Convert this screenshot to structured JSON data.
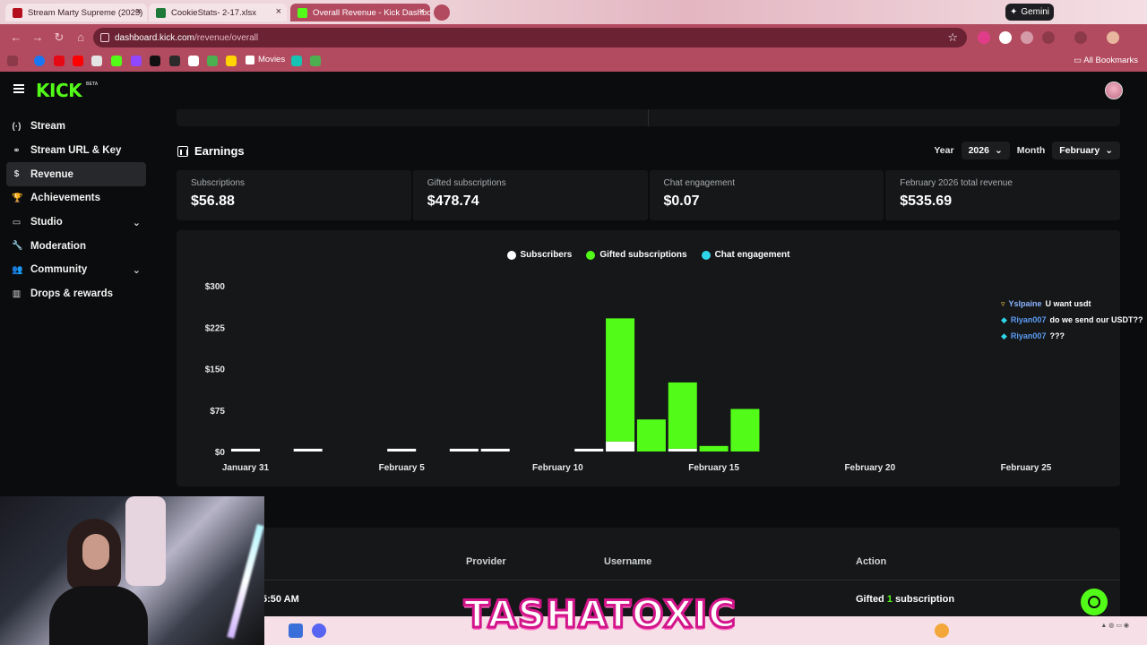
{
  "browser": {
    "tabs": [
      {
        "title": "Stream Marty Supreme (2025)",
        "fav": "#b30f1c"
      },
      {
        "title": "CookieStats- 2-17.xlsx",
        "fav": "#1f7a3a"
      },
      {
        "title": "Overall Revenue - Kick Dashbo",
        "fav": "#53fc18"
      }
    ],
    "gemini_label": "Gemini",
    "url_domain": "dashboard.kick.com",
    "url_path": "/revenue/overall",
    "bookmark_movies": "Movies",
    "all_bookmarks": "All Bookmarks"
  },
  "app": {
    "logo": "KICK",
    "beta": "BETA",
    "sidebar": [
      {
        "label": "Stream",
        "icon": "(·)"
      },
      {
        "label": "Stream URL & Key",
        "icon": "⚭"
      },
      {
        "label": "Revenue",
        "icon": "$",
        "active": true
      },
      {
        "label": "Achievements",
        "icon": "🏆"
      },
      {
        "label": "Studio",
        "icon": "▭",
        "expand": true
      },
      {
        "label": "Moderation",
        "icon": "🔧"
      },
      {
        "label": "Community",
        "icon": "👥",
        "expand": true
      },
      {
        "label": "Drops & rewards",
        "icon": "▥"
      }
    ],
    "earnings": {
      "title": "Earnings",
      "year_label": "Year",
      "year_value": "2026",
      "month_label": "Month",
      "month_value": "February"
    },
    "stats": [
      {
        "title": "Subscriptions",
        "value": "$56.88"
      },
      {
        "title": "Gifted subscriptions",
        "value": "$478.74"
      },
      {
        "title": "Chat engagement",
        "value": "$0.07"
      },
      {
        "title": "February 2026 total revenue",
        "value": "$535.69"
      }
    ],
    "legend": [
      {
        "label": "Subscribers",
        "color": "#ffffff"
      },
      {
        "label": "Gifted subscriptions",
        "color": "#53fc18"
      },
      {
        "label": "Chat engagement",
        "color": "#2fd6ea"
      }
    ],
    "table": {
      "headers": [
        "Provider",
        "Username",
        "Action"
      ],
      "row_time": "5:50 AM",
      "row_action_prefix": "Gifted",
      "row_action_count": "1",
      "row_action_suffix": "subscription"
    }
  },
  "chat": [
    {
      "user": "Yslpaine",
      "msg": "U want usdt"
    },
    {
      "user": "Riyan007",
      "msg": "do we send our USDT??"
    },
    {
      "user": "Riyan007",
      "msg": "???"
    }
  ],
  "overlay_banner": "TASHATOXIC",
  "chart_data": {
    "type": "bar",
    "stacked": true,
    "x_tick_labels": [
      "January 31",
      "February 5",
      "February 10",
      "February 15",
      "February 20",
      "February 25"
    ],
    "y_tick_labels": [
      "$0",
      "$75",
      "$150",
      "$225",
      "$300"
    ],
    "ylim": [
      0,
      300
    ],
    "categories": [
      "Jan 31",
      "Feb 1",
      "Feb 2",
      "Feb 3",
      "Feb 4",
      "Feb 5",
      "Feb 6",
      "Feb 7",
      "Feb 8",
      "Feb 9",
      "Feb 10",
      "Feb 11",
      "Feb 12",
      "Feb 13",
      "Feb 14",
      "Feb 15",
      "Feb 16"
    ],
    "series": [
      {
        "name": "Subscribers",
        "values": [
          5,
          0,
          5,
          0,
          0,
          5,
          0,
          5,
          5,
          0,
          0,
          5,
          18,
          0,
          5,
          0,
          0
        ]
      },
      {
        "name": "Gifted subscriptions",
        "values": [
          0,
          0,
          0,
          0,
          0,
          0,
          0,
          0,
          0,
          0,
          0,
          0,
          223,
          58,
          120,
          10,
          77
        ]
      },
      {
        "name": "Chat engagement",
        "values": [
          0,
          0,
          0,
          0,
          0,
          0,
          0,
          0,
          0,
          0,
          0,
          0,
          0,
          0,
          0,
          0,
          0
        ]
      }
    ]
  }
}
